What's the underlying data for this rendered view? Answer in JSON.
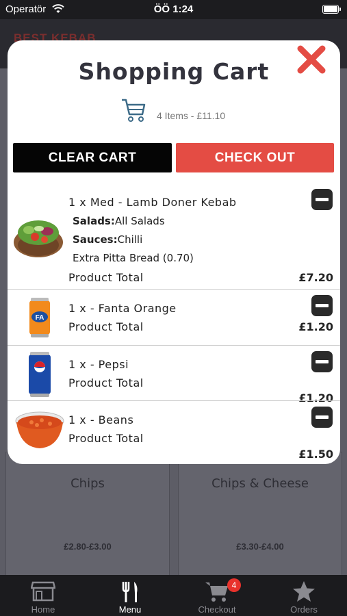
{
  "status_bar": {
    "carrier": "Operatör",
    "time": "ÖÖ 1:24"
  },
  "background": {
    "brand": "BEST KEBAB",
    "cards": [
      {
        "name": "Chips",
        "price": "£2.80-£3.00"
      },
      {
        "name": "Chips & Cheese",
        "price": "£3.30-£4.00"
      }
    ]
  },
  "modal": {
    "title": "Shopping Cart",
    "summary": "4 Items - £11.10",
    "clear_label": "CLEAR CART",
    "checkout_label": "CHECK OUT"
  },
  "items": [
    {
      "title": "1 x Med - Lamb Doner Kebab",
      "details": [
        {
          "label": "Salads:",
          "value": "All Salads"
        },
        {
          "label": "Sauces:",
          "value": "Chilli"
        },
        {
          "label": "",
          "value": "Extra Pitta Bread (0.70)"
        }
      ],
      "total_label": "Product Total",
      "price": "£7.20",
      "icon": "kebab-image"
    },
    {
      "title": "1 x - Fanta Orange",
      "total_label": "Product Total",
      "price": "£1.20",
      "icon": "fanta-can-image"
    },
    {
      "title": "1 x - Pepsi",
      "total_label": "Product Total",
      "price": "£1.20",
      "icon": "pepsi-can-image"
    },
    {
      "title": "1 x - Beans",
      "total_label": "Product Total",
      "price": "£1.50",
      "icon": "beans-bowl-image"
    }
  ],
  "tabs": [
    {
      "label": "Home",
      "icon": "store-icon"
    },
    {
      "label": "Menu",
      "icon": "fork-knife-icon",
      "active": true
    },
    {
      "label": "Checkout",
      "icon": "cart-icon",
      "badge": "4"
    },
    {
      "label": "Orders",
      "icon": "star-icon"
    }
  ],
  "colors": {
    "accent_red": "#e44c44",
    "clear_black": "#050505",
    "title": "#33333d",
    "badge": "#e8322c"
  }
}
